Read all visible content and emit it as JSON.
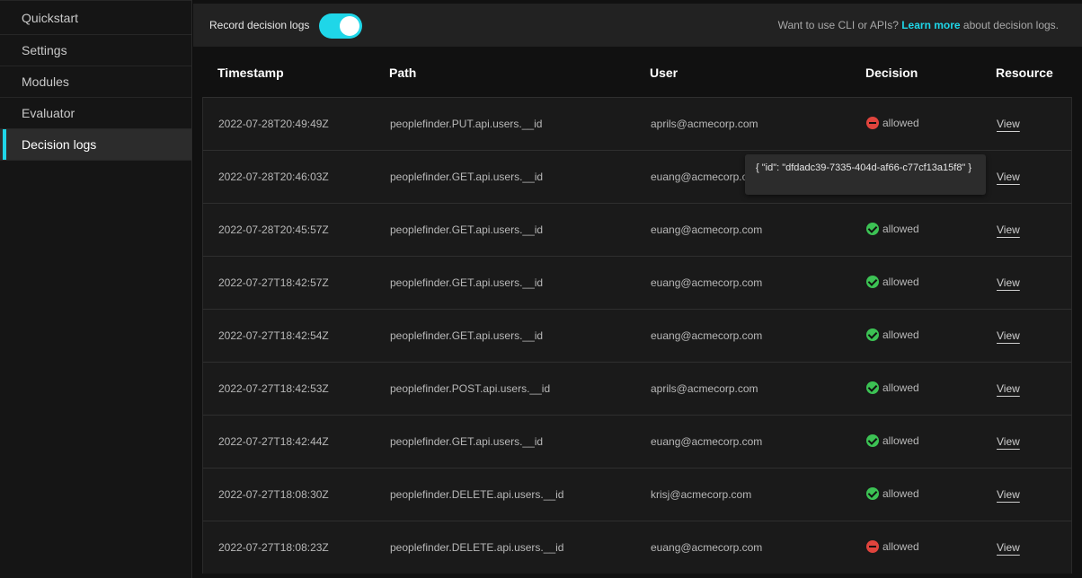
{
  "sidebar": {
    "items": [
      {
        "label": "Quickstart",
        "active": false
      },
      {
        "label": "Settings",
        "active": false
      },
      {
        "label": "Modules",
        "active": false
      },
      {
        "label": "Evaluator",
        "active": false
      },
      {
        "label": "Decision logs",
        "active": true
      }
    ]
  },
  "topbar": {
    "record_label": "Record decision logs",
    "record_enabled": true,
    "help_prefix": "Want to use CLI or APIs?",
    "help_link": "Learn more",
    "help_suffix": "about decision logs."
  },
  "table": {
    "columns": [
      "Timestamp",
      "Path",
      "User",
      "Decision",
      "Resource"
    ],
    "rows": [
      {
        "timestamp": "2022-07-28T20:49:49Z",
        "path": "peoplefinder.PUT.api.users.__id",
        "user": "aprils@acmecorp.com",
        "decision": "allowed",
        "status": "deny",
        "resource": "View"
      },
      {
        "timestamp": "2022-07-28T20:46:03Z",
        "path": "peoplefinder.GET.api.users.__id",
        "user": "euang@acmecorp.com",
        "decision": "",
        "status": "",
        "resource": "View"
      },
      {
        "timestamp": "2022-07-28T20:45:57Z",
        "path": "peoplefinder.GET.api.users.__id",
        "user": "euang@acmecorp.com",
        "decision": "allowed",
        "status": "ok",
        "resource": "View"
      },
      {
        "timestamp": "2022-07-27T18:42:57Z",
        "path": "peoplefinder.GET.api.users.__id",
        "user": "euang@acmecorp.com",
        "decision": "allowed",
        "status": "ok",
        "resource": "View"
      },
      {
        "timestamp": "2022-07-27T18:42:54Z",
        "path": "peoplefinder.GET.api.users.__id",
        "user": "euang@acmecorp.com",
        "decision": "allowed",
        "status": "ok",
        "resource": "View"
      },
      {
        "timestamp": "2022-07-27T18:42:53Z",
        "path": "peoplefinder.POST.api.users.__id",
        "user": "aprils@acmecorp.com",
        "decision": "allowed",
        "status": "ok",
        "resource": "View"
      },
      {
        "timestamp": "2022-07-27T18:42:44Z",
        "path": "peoplefinder.GET.api.users.__id",
        "user": "euang@acmecorp.com",
        "decision": "allowed",
        "status": "ok",
        "resource": "View"
      },
      {
        "timestamp": "2022-07-27T18:08:30Z",
        "path": "peoplefinder.DELETE.api.users.__id",
        "user": "krisj@acmecorp.com",
        "decision": "allowed",
        "status": "ok",
        "resource": "View"
      },
      {
        "timestamp": "2022-07-27T18:08:23Z",
        "path": "peoplefinder.DELETE.api.users.__id",
        "user": "euang@acmecorp.com",
        "decision": "allowed",
        "status": "deny",
        "resource": "View"
      }
    ]
  },
  "tooltip": {
    "text": "{ \"id\": \"dfdadc39-7335-404d-af66-c77cf13a15f8\" }"
  },
  "colors": {
    "accent": "#1fd6e8",
    "allowed_icon": "#3cc254",
    "denied_icon": "#e0443d"
  }
}
